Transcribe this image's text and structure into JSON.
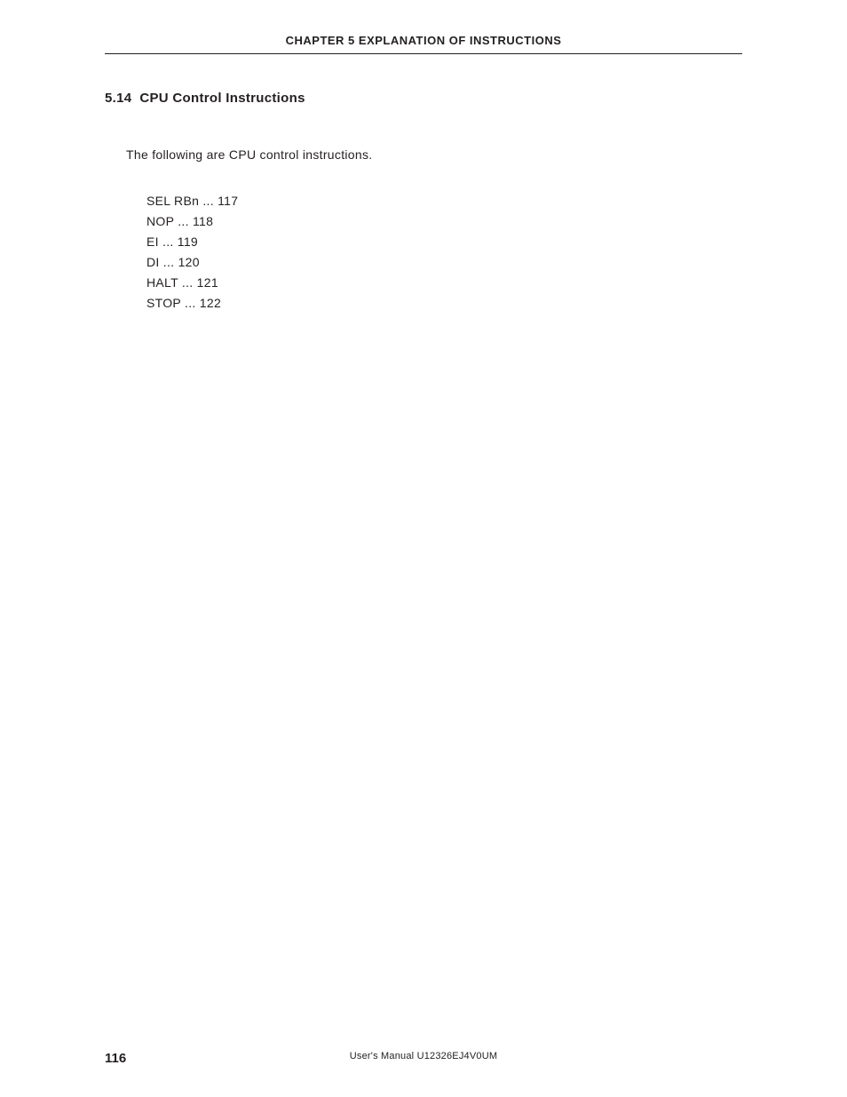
{
  "header": {
    "chapter_title": "CHAPTER 5   EXPLANATION OF INSTRUCTIONS"
  },
  "section": {
    "number": "5.14",
    "title": "CPU Control Instructions"
  },
  "intro": "The following are CPU control instructions.",
  "instructions": [
    {
      "name": "SEL RBn",
      "page": "117"
    },
    {
      "name": "NOP",
      "page": "118"
    },
    {
      "name": "EI",
      "page": "119"
    },
    {
      "name": "DI",
      "page": "120"
    },
    {
      "name": "HALT",
      "page": "121"
    },
    {
      "name": "STOP",
      "page": "122"
    }
  ],
  "footer": {
    "page_number": "116",
    "manual_ref": "User's Manual  U12326EJ4V0UM"
  }
}
